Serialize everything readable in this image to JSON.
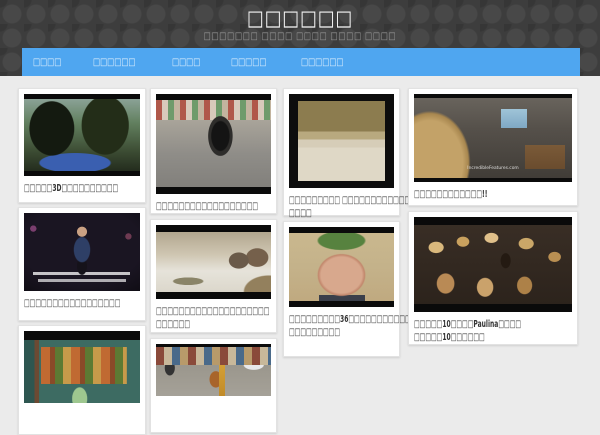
{
  "site": {
    "title": "□□□□□□",
    "subtitle": "□□□□□□□ □□□□ □□□□ □□□□ □□□□"
  },
  "nav": {
    "items": [
      {
        "label": "□□□□"
      },
      {
        "label": "□□□□□□"
      },
      {
        "label": "□□□□"
      },
      {
        "label": "□□□□□"
      },
      {
        "label": "□□□□□□"
      }
    ]
  },
  "colors": {
    "header_bg": "#3d3d3d",
    "nav_bg": "#4fa6f0",
    "page_bg": "#ebebeb",
    "card_bg": "#ffffff",
    "caption_text": "#333333"
  },
  "cards": [
    {
      "name": "king-kong-3d-ride",
      "image": "king-kong-fighting-dinosaurs-over-tour-tram",
      "caption1": "□□□□□3D□□□□□□□□□□",
      "caption2": ""
    },
    {
      "name": "motorcycle-stunt",
      "image": "stunt-rider-drifting-motorcycle-before-crowd",
      "caption1": "□□□□□□□□□□□□□□□□□□",
      "caption2": ""
    },
    {
      "name": "cat-on-stairs",
      "image": "white-cat-sliding-down-carpeted-stairs",
      "caption1": "□□□□□□□□□ □□□□□□□□□□□□",
      "caption2": "□□□□"
    },
    {
      "name": "girl-watching-tv",
      "image": "blonde-girl-in-bedroom-using-remote-at-tv",
      "watermark": "IncredibleFeatures.com",
      "caption1": "□□□□□□□□□□□□!!",
      "caption2": ""
    },
    {
      "name": "comedian-on-stage",
      "image": "bald-comedian-in-blue-shirt-on-dark-stage-with-subtitles",
      "caption1": "□□□□□□□□□□□□□□□□□",
      "caption2": ""
    },
    {
      "name": "wildebeest-cliff",
      "image": "animated-wildebeest-on-cliff-edge-above-crocodile",
      "caption1": "□□□□□□□□□□□□□□□□□□□□",
      "caption2": "□□□□□□"
    },
    {
      "name": "pregnant-belly",
      "image": "pregnant-belly-woman-in-green-top-on-couch",
      "caption1": "□□□□□□□□□36□□□□□□□□□□□□",
      "caption2": "□□□□□□□□□"
    },
    {
      "name": "girl-drummer",
      "image": "young-girl-playing-huge-drum-kit-with-cymbals",
      "caption1": "□□□□□10□□□□Paulina□□□□",
      "caption2": "□□□□□10□□□□□□"
    },
    {
      "name": "gallery-painting",
      "image": "animated-woman-in-green-dress-before-large-painting",
      "caption1": "",
      "caption2": ""
    },
    {
      "name": "street-dog",
      "image": "street-scene-with-moped-bicycles-dog-and-yellow-pole",
      "caption1": "",
      "caption2": ""
    }
  ]
}
